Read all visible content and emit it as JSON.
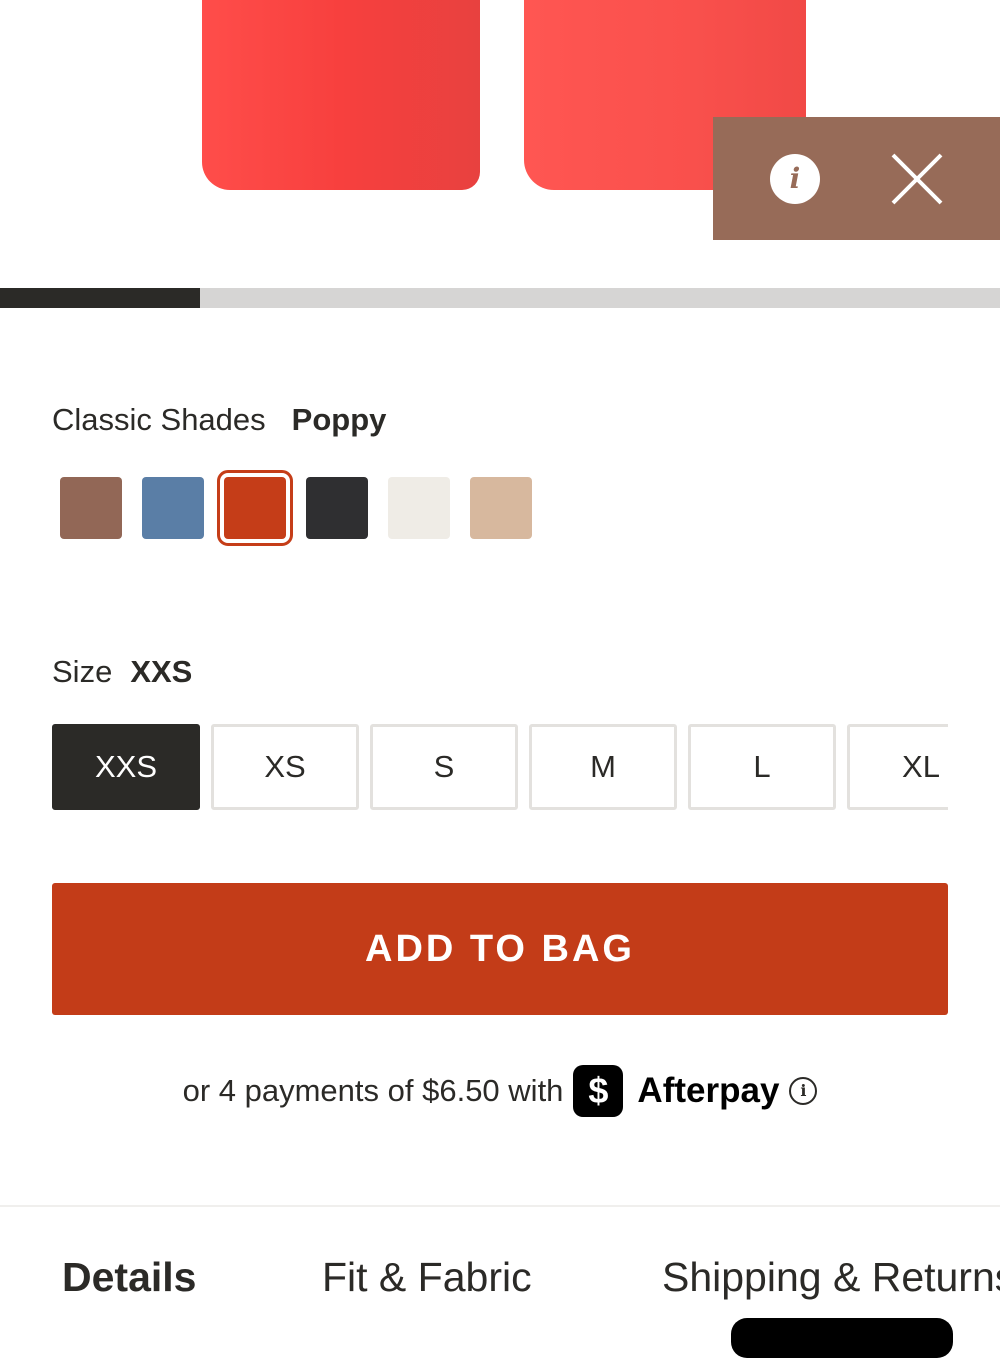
{
  "hero": {
    "product_color": "#f04b46",
    "info_icon": "info-icon",
    "close_icon": "close-icon",
    "panel_color": "#976b58"
  },
  "carousel": {
    "progress": 0.2
  },
  "color_picker": {
    "label": "Classic Shades",
    "selected": "Poppy",
    "swatches": [
      {
        "name": "brown",
        "color": "#926756"
      },
      {
        "name": "blue",
        "color": "#5a7ea6"
      },
      {
        "name": "poppy",
        "color": "#c53d18",
        "selected": true
      },
      {
        "name": "black",
        "color": "#2f2f31"
      },
      {
        "name": "white",
        "color": "#efece6"
      },
      {
        "name": "tan",
        "color": "#d7b89e"
      }
    ]
  },
  "size_picker": {
    "label": "Size",
    "selected": "XXS",
    "options": [
      "XXS",
      "XS",
      "S",
      "M",
      "L",
      "XL"
    ]
  },
  "add_to_bag": {
    "label": "ADD TO BAG",
    "color": "#c33c18"
  },
  "afterpay": {
    "text": "or 4 payments of $6.50 with",
    "badge": "$",
    "brand": "Afterpay"
  },
  "tabs": [
    {
      "label": "Details",
      "active": true
    },
    {
      "label": "Fit & Fabric",
      "active": false
    },
    {
      "label": "Shipping & Returns",
      "active": false
    }
  ]
}
